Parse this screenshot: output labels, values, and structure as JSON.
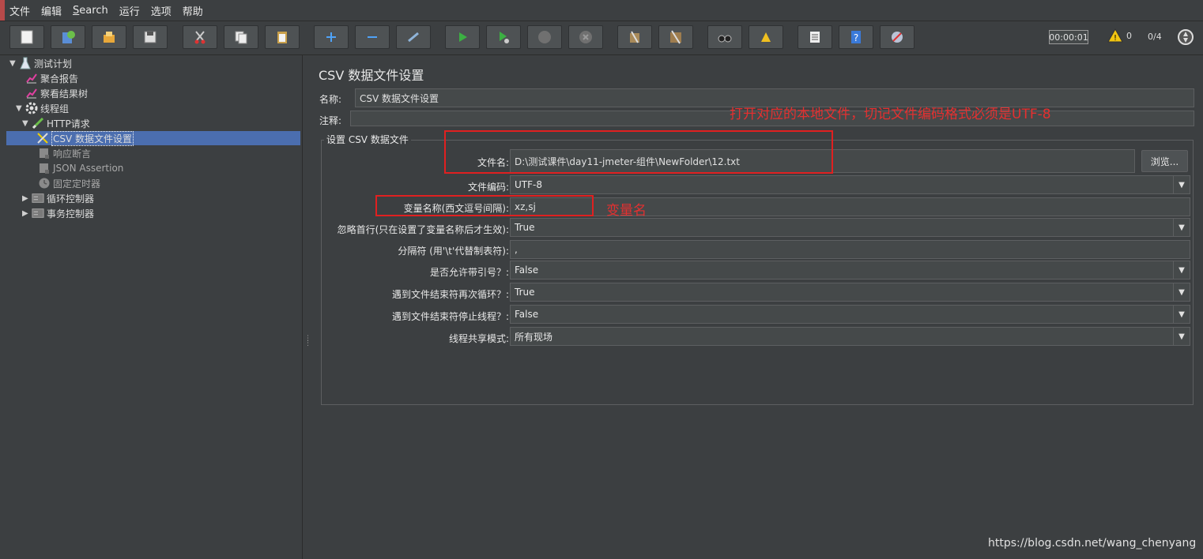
{
  "menu": {
    "items": [
      "文件",
      "编辑",
      "Search",
      "运行",
      "选项",
      "帮助"
    ]
  },
  "toolbar": {
    "buttons": [
      "new-icon",
      "templates-icon",
      "open-icon",
      "save-icon",
      "cut-icon",
      "copy-icon",
      "paste-icon",
      "expand-icon",
      "collapse-icon",
      "toggle-icon",
      "start-icon",
      "start-no-pause-icon",
      "stop-icon",
      "shutdown-icon",
      "clear-icon",
      "clear-all-icon",
      "search-icon",
      "reset-search-icon",
      "function-helper-icon",
      "help-icon",
      "remote-icon"
    ],
    "timer": "00:00:01",
    "warnings": "0",
    "threads": "0/4"
  },
  "tree": {
    "nodes": [
      {
        "label": "测试计划",
        "icon": "test-plan-icon"
      },
      {
        "label": "聚合报告",
        "icon": "report-chart-icon"
      },
      {
        "label": "察看结果树",
        "icon": "report-chart-icon"
      },
      {
        "label": "线程组",
        "icon": "gear-icon"
      },
      {
        "label": "HTTP请求",
        "icon": "pen-icon"
      },
      {
        "label": "CSV 数据文件设置",
        "icon": "wrench-icon"
      },
      {
        "label": "响应断言",
        "icon": "assertion-icon"
      },
      {
        "label": "JSON Assertion",
        "icon": "assertion-icon"
      },
      {
        "label": "固定定时器",
        "icon": "timer-icon"
      },
      {
        "label": "循环控制器",
        "icon": "controller-icon"
      },
      {
        "label": "事务控制器",
        "icon": "controller-icon"
      }
    ]
  },
  "form": {
    "title": "CSV 数据文件设置",
    "name_label": "名称:",
    "name_value": "CSV 数据文件设置",
    "comment_label": "注释:",
    "comment_value": "",
    "group_title": "设置 CSV 数据文件",
    "filename_label": "文件名:",
    "filename_value": "D:\\测试课件\\day11-jmeter-组件\\NewFolder\\12.txt",
    "browse_label": "浏览...",
    "encoding_label": "文件编码:",
    "encoding_value": "UTF-8",
    "varnames_label": "变量名称(西文逗号间隔):",
    "varnames_value": "xz,sj",
    "ignore_first_label": "忽略首行(只在设置了变量名称后才生效):",
    "ignore_first_value": "True",
    "delimiter_label": "分隔符 (用'\\t'代替制表符):",
    "delimiter_value": ",",
    "quoted_label": "是否允许带引号？:",
    "quoted_value": "False",
    "recycle_label": "遇到文件结束符再次循环？:",
    "recycle_value": "True",
    "stop_thread_label": "遇到文件结束符停止线程？:",
    "stop_thread_value": "False",
    "share_mode_label": "线程共享模式:",
    "share_mode_value": "所有现场"
  },
  "annotations": {
    "file_note": "打开对应的本地文件，切记文件编码格式必须是UTF-8",
    "var_note": "变量名",
    "color": "#e02020"
  },
  "watermark": "https://blog.csdn.net/wang_chenyang"
}
